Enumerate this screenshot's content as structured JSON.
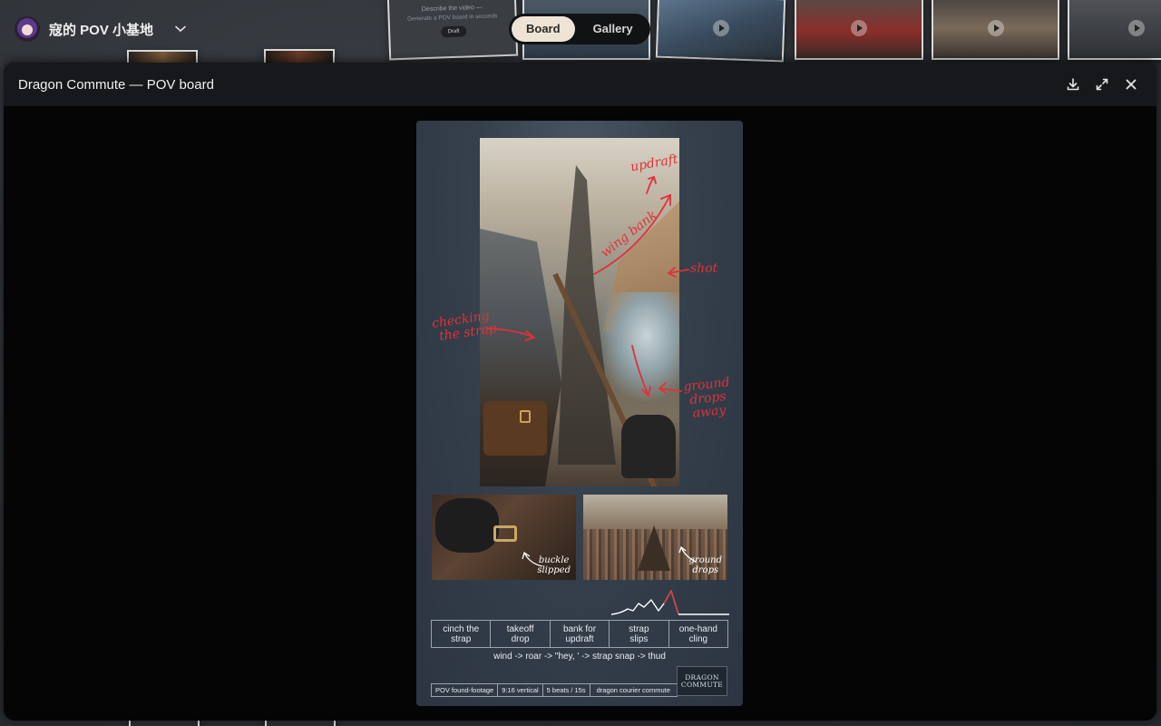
{
  "app": {
    "brand_name": "寇的 POV 小基地",
    "brand_icon": "avatar-icon",
    "switcher_icon": "chevron-down-icon"
  },
  "view_toggle": {
    "options": [
      "Board",
      "Gallery"
    ],
    "selected": "Board"
  },
  "background_card": {
    "line1": "Describe the video —",
    "line2": "Generate a POV board in seconds",
    "button": "Draft"
  },
  "modal": {
    "title": "Dragon Commute — POV board",
    "actions": {
      "download": "download-icon",
      "expand": "expand-icon",
      "close": "close-icon"
    }
  },
  "poster": {
    "hero_annotations": {
      "updraft": "updraft",
      "wing_bank": "wing bank",
      "shot": "shot",
      "checking_line1": "checking",
      "checking_line2": "the strap",
      "ground_line1": "ground",
      "ground_line2": "drops",
      "ground_line3": "away"
    },
    "thumbs": [
      {
        "line1": "buckle",
        "line2": "slipped"
      },
      {
        "line1": "ground",
        "line2": "drops"
      }
    ],
    "beats": [
      {
        "line1": "cinch the",
        "line2": "strap"
      },
      {
        "line1": "takeoff",
        "line2": "drop"
      },
      {
        "line1": "bank for",
        "line2": "updraft"
      },
      {
        "line1": "strap",
        "line2": "slips"
      },
      {
        "line1": "one-hand",
        "line2": "cling"
      }
    ],
    "sound_line": "wind -> roar -> \"hey, ' -> strap snap -> thud",
    "tags": [
      "POV found-footage",
      "9:16 vertical",
      "5 beats / 15s",
      "dragon courier commute"
    ],
    "logo_line1": "DRAGON",
    "logo_line2": "COMMUTE"
  },
  "colors": {
    "annotation_red": "#e0313a",
    "toggle_active_bg": "#efe3d6",
    "modal_header": "#17181b"
  }
}
